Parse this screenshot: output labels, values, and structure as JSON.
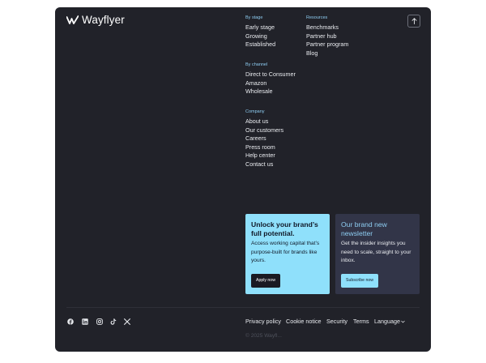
{
  "brand": {
    "name": "Wayflyer"
  },
  "nav": {
    "by_stage": {
      "heading": "By stage",
      "links": [
        "Early stage",
        "Growing",
        "Established"
      ]
    },
    "resources": {
      "heading": "Resources",
      "links": [
        "Benchmarks",
        "Partner hub",
        "Partner program",
        "Blog"
      ]
    },
    "by_channel": {
      "heading": "By channel",
      "links": [
        "Direct to Consumer",
        "Amazon",
        "Wholesale"
      ]
    },
    "company": {
      "heading": "Company",
      "links": [
        "About us",
        "Our customers",
        "Careers",
        "Press room",
        "Help center",
        "Contact us"
      ]
    }
  },
  "cards": {
    "apply": {
      "title": "Unlock your brand’s full potential.",
      "text": "Access working capital that’s purpose-built for brands like yours.",
      "button": "Apply now"
    },
    "newsletter": {
      "title": "Our brand new newsletter",
      "text": "Get the insider insights you need to scale, straight to your inbox.",
      "button": "Subscribe now"
    }
  },
  "social": [
    "facebook-icon",
    "linkedin-icon",
    "instagram-icon",
    "tiktok-icon",
    "x-icon"
  ],
  "legal": {
    "privacy": "Privacy policy",
    "cookie": "Cookie notice",
    "security": "Security",
    "terms": "Terms",
    "language": "Language"
  },
  "copyright": "© 2025 Wayfl..."
}
